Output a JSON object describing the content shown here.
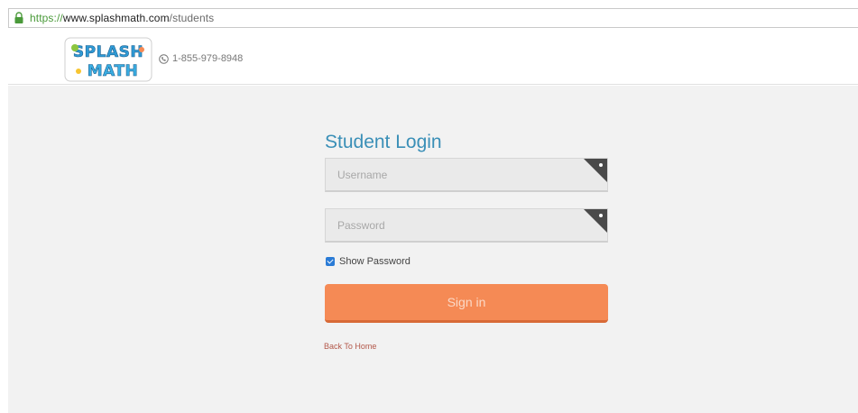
{
  "browser": {
    "url_scheme": "https://",
    "url_host": "www.splashmath.com",
    "url_path": "/students",
    "lock_icon": "lock-icon"
  },
  "header": {
    "logo_text_top": "SPLASH",
    "logo_text_bottom": "MATH",
    "phone_icon": "phone-icon",
    "phone_number": "1-855-979-8948"
  },
  "login": {
    "title": "Student Login",
    "username_placeholder": "Username",
    "username_value": "",
    "password_placeholder": "Password",
    "password_value": "",
    "show_password_label": "Show Password",
    "show_password_checked": true,
    "sign_in_label": "Sign in",
    "back_home_label": "Back To Home"
  },
  "colors": {
    "title": "#3a8fb7",
    "button": "#f58a55",
    "checkbox": "#2a7bd6",
    "link": "#b3584a",
    "background": "#f2f2f2"
  }
}
